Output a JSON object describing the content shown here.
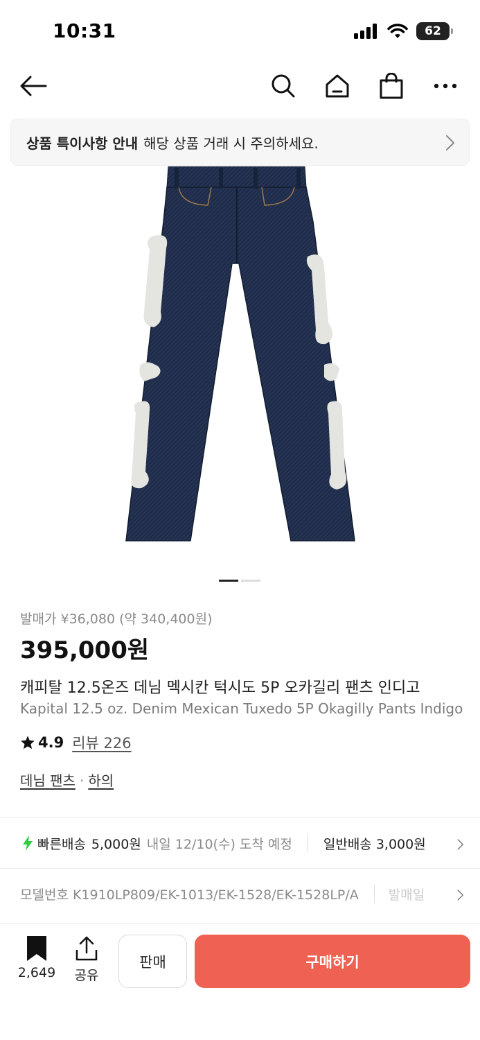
{
  "status_bar": {
    "time": "10:31",
    "battery": "62"
  },
  "nav": {
    "icons": [
      "back-arrow-icon",
      "search-icon",
      "home-icon",
      "shopping-bag-icon",
      "more-icon"
    ]
  },
  "notice": {
    "strong": "상품 특이사항 안내",
    "text": "해당 상품 거래 시 주의하세요."
  },
  "gallery": {
    "current_page": 1,
    "total_pages": 2
  },
  "product": {
    "release_price": "발매가 ¥36,080 (약 340,400원)",
    "price": "395,000원",
    "title_ko": "캐피탈 12.5온즈 데님 멕시칸 턱시도 5P 오카길리 팬츠 인디고",
    "title_en": "Kapital 12.5 oz. Denim Mexican Tuxedo 5P Okagilly Pants Indigo",
    "rating": "4.9",
    "review_label": "리뷰 226",
    "category_1": "데님 팬츠",
    "separator": "·",
    "category_2": "하의"
  },
  "shipping": {
    "fast_label": "빠른배송",
    "fast_fee": "5,000원",
    "fast_eta": "내일 12/10(수) 도착 예정",
    "normal_label": "일반배송 3,000원"
  },
  "model": {
    "text": "모델번호 K1910LP809/EK-1013/EK-1528/EK-1528LP/A",
    "more": "발매일"
  },
  "bottom": {
    "wish_count": "2,649",
    "share_label": "공유",
    "sell_label": "판매",
    "buy_label": "구매하기"
  },
  "colors": {
    "accent": "#ef6253",
    "fast_bolt": "#2ecc40",
    "denim": "#1f2d4a"
  }
}
